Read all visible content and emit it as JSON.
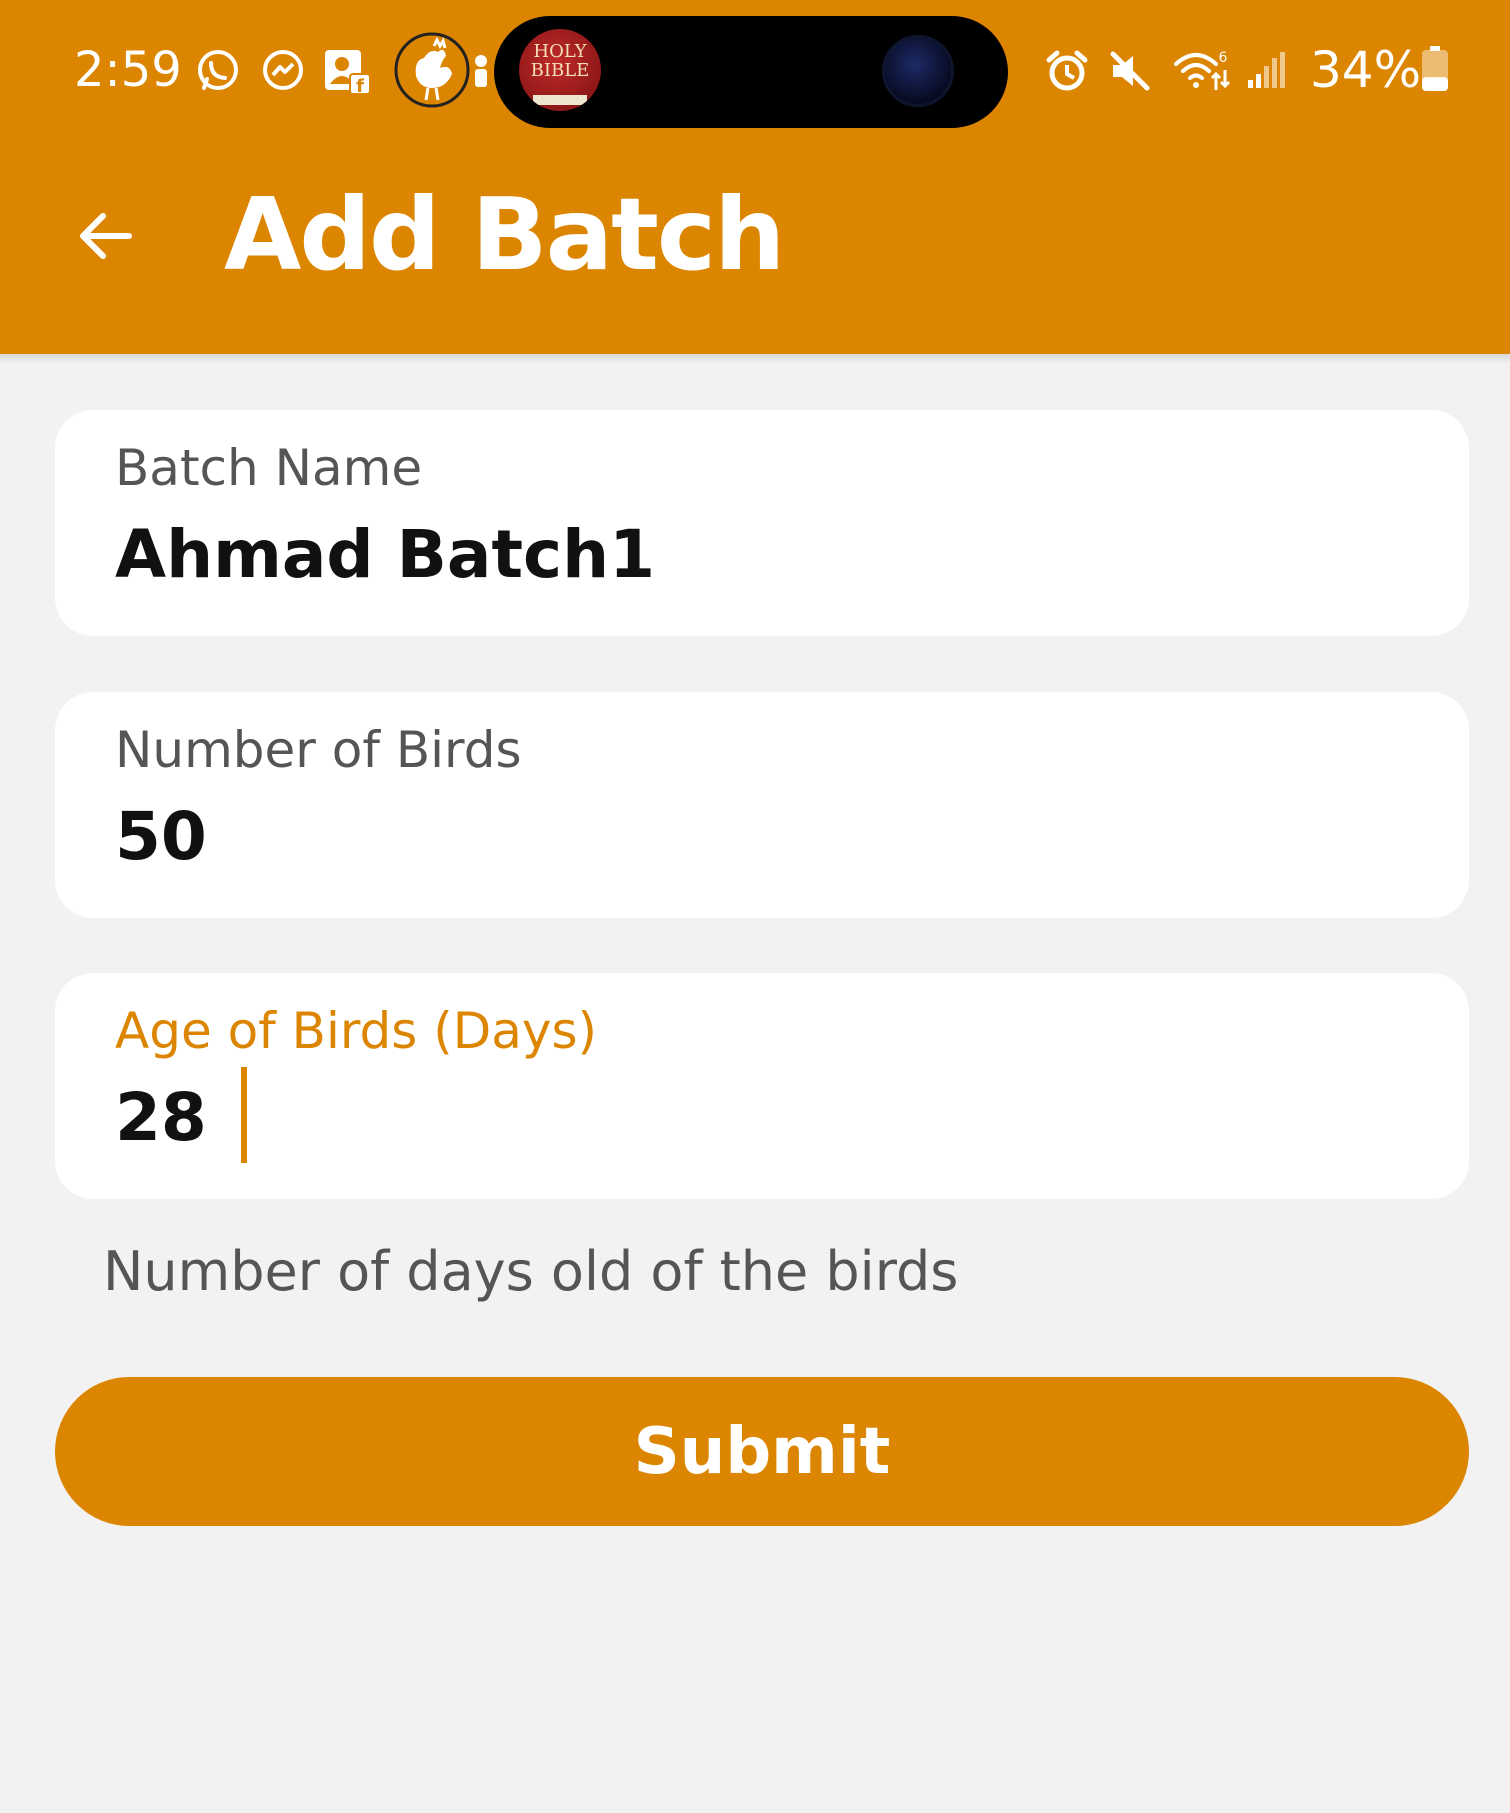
{
  "status_bar": {
    "time": "2:59",
    "battery_percent": "34%",
    "left_icons": [
      "whatsapp-icon",
      "messenger-icon",
      "facebook-contacts-icon",
      "rooster-app-icon",
      "notification-dot-icon"
    ],
    "right_icons": [
      "alarm-icon",
      "mute-icon",
      "wifi-icon",
      "signal-icon",
      "battery-icon"
    ],
    "floating_app": {
      "line1": "HOLY",
      "line2": "BIBLE"
    },
    "battery_level": 0.34
  },
  "app_bar": {
    "title": "Add Batch",
    "back_icon": "arrow-left-icon"
  },
  "form": {
    "batch_name": {
      "label": "Batch Name",
      "value": "Ahmad Batch1"
    },
    "number_of_birds": {
      "label": "Number of Birds",
      "value": "50"
    },
    "age_of_birds": {
      "label": "Age of Birds (Days)",
      "value": "28",
      "helper": "Number of days old of the birds"
    },
    "submit_label": "Submit"
  },
  "colors": {
    "primary": "#dc8500",
    "background": "#f2f2f2",
    "card": "#ffffff",
    "label": "#555555",
    "value": "#111111"
  }
}
